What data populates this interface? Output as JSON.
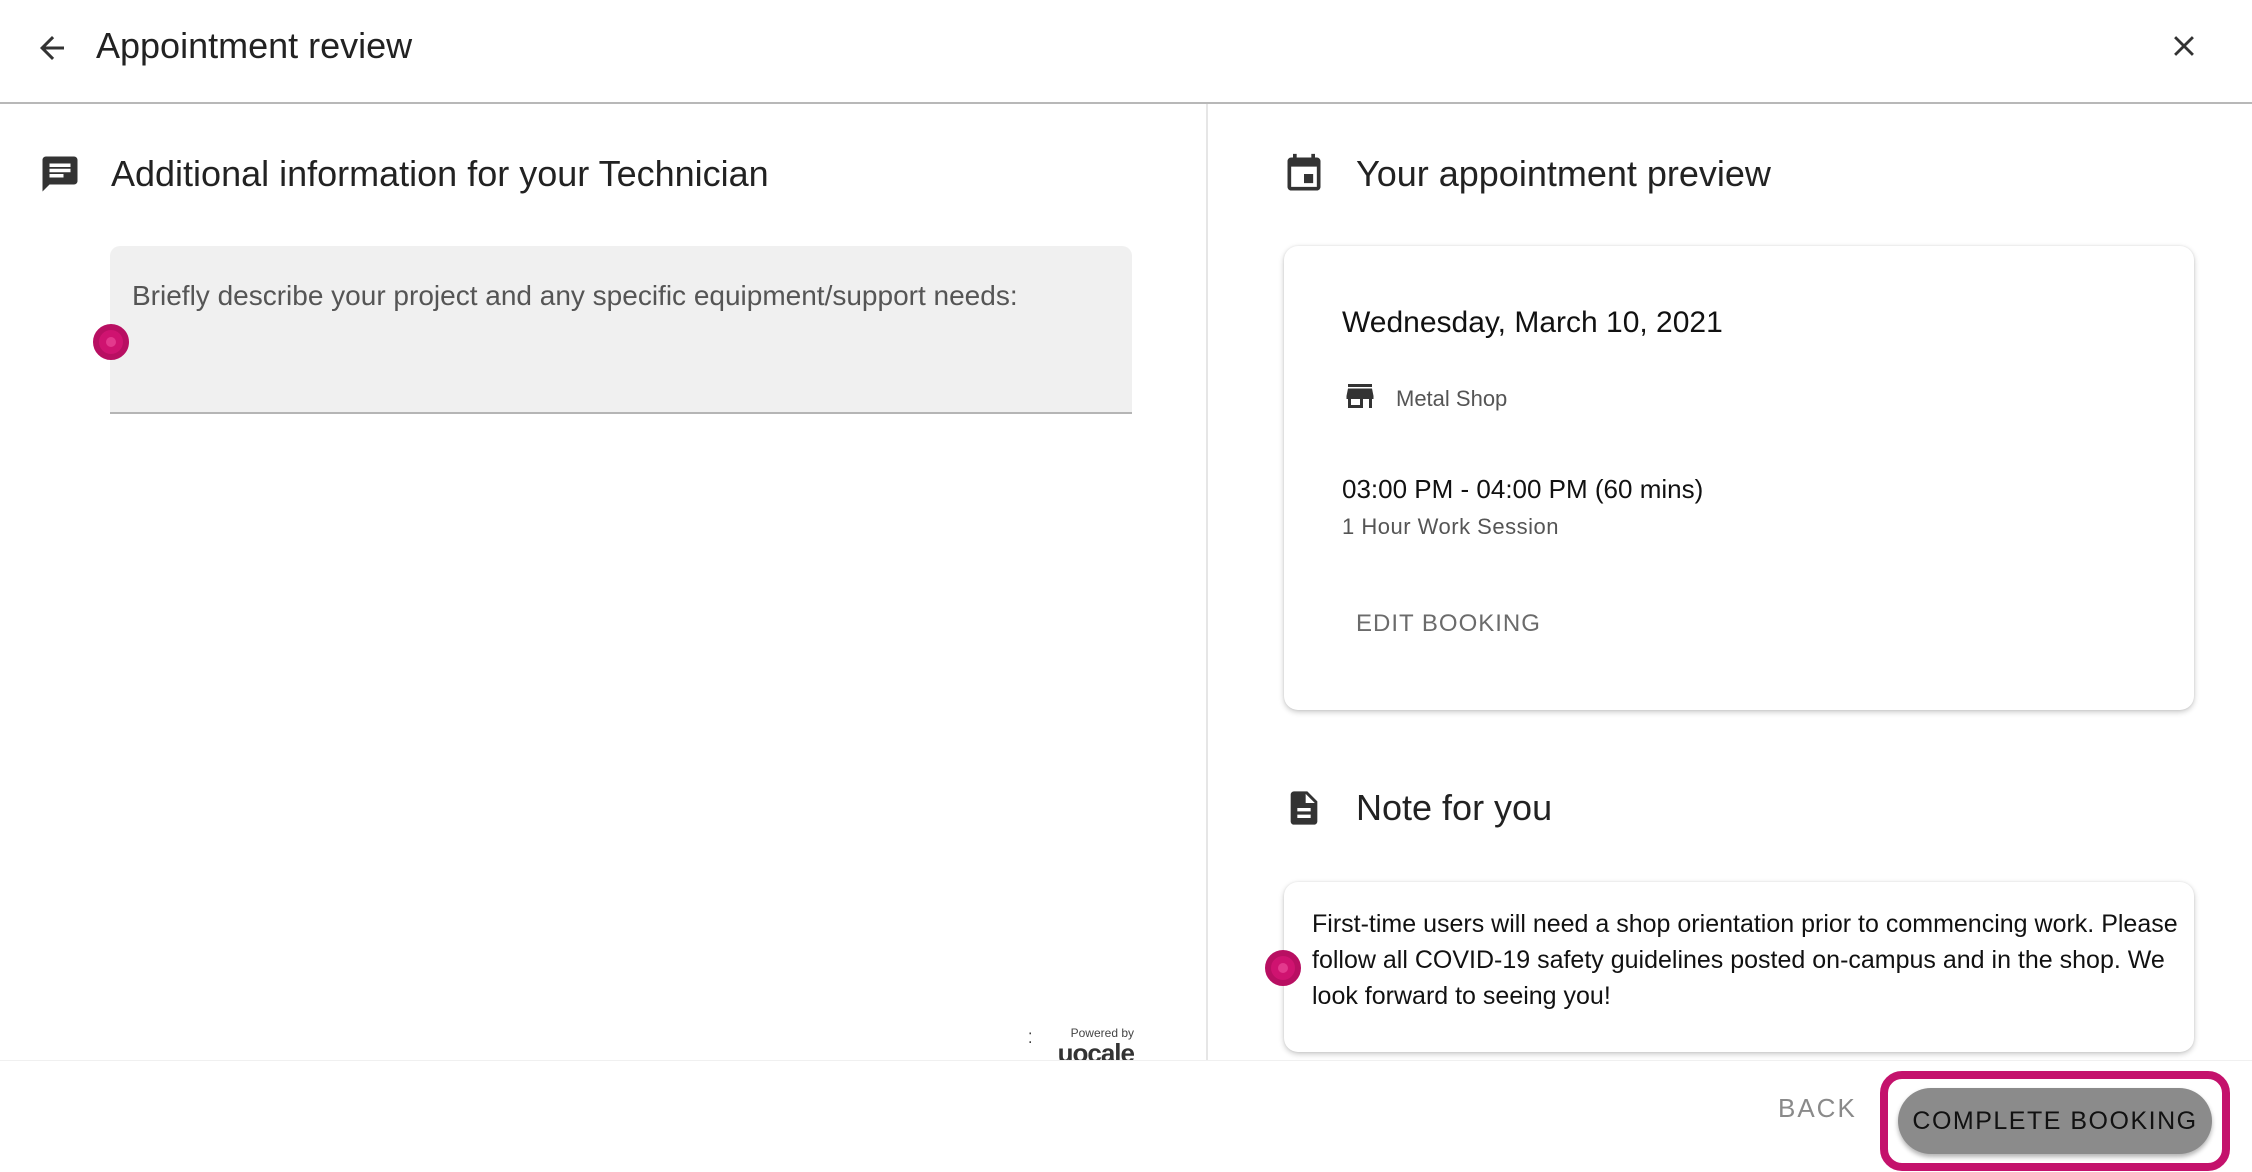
{
  "header": {
    "title": "Appointment review",
    "back_icon": "arrow-left-icon",
    "close_icon": "close-icon"
  },
  "left": {
    "section_title": "Additional information for your Technician",
    "section_icon": "message-icon",
    "textarea_placeholder": "Briefly describe your project and any specific equipment/support needs:",
    "powered_by": "Powered by",
    "powered_logo": "uocale"
  },
  "preview": {
    "section_title": "Your appointment preview",
    "section_icon": "calendar-icon",
    "date": "Wednesday, March 10, 2021",
    "location": "Metal Shop",
    "location_icon": "store-icon",
    "time_range": "03:00 PM - 04:00 PM (60 mins)",
    "session_type": "1 Hour Work Session",
    "edit_label": "EDIT BOOKING"
  },
  "note": {
    "section_title": "Note for you",
    "section_icon": "document-icon",
    "text": "First-time users will need a shop orientation prior to commencing work. Please follow all COVID-19 safety guidelines posted on-campus and in the shop. We look forward to seeing you!"
  },
  "footer": {
    "back_label": "BACK",
    "complete_label": "COMPLETE BOOKING"
  },
  "colors": {
    "highlight": "#c4126c",
    "marker": "#cf1370",
    "complete_button_bg": "#8b8b8b"
  }
}
